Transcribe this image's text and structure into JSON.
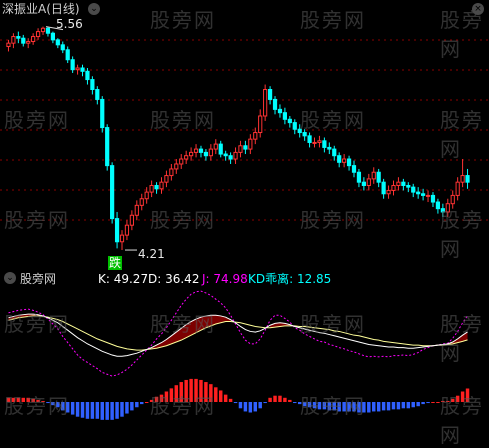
{
  "main_panel": {
    "title": "深振业A(日线)",
    "high_label": "5.56",
    "low_label": "4.21",
    "signal_text": "跌",
    "title_color": "#d0d0d0",
    "high_color": "#e6e6e6",
    "low_color": "#e6e6e6",
    "signal_color": "#00c000"
  },
  "indicator_panel": {
    "name": "股旁网",
    "k_label": "K: 49.27",
    "d_label": "D: 36.42",
    "j_label": "J: 74.98",
    "kd_label": "KD乖离: 12.85",
    "k_color": "#ffffff",
    "d_color": "#ffffff",
    "j_color": "#ff00ff",
    "kd_color": "#00ffff"
  },
  "watermark": "股旁网",
  "colors": {
    "up": "#ff3333",
    "down": "#00ffff",
    "grid": "#8b0000",
    "k_line": "#ffffff",
    "d_line": "#ffff99",
    "j_line": "#ff00ff",
    "kd_pos": "#ff2020",
    "kd_neg": "#3060ff",
    "band_fill": "#8b0000"
  },
  "chart_data": [
    {
      "type": "candlestick",
      "x": [
        "1",
        "2",
        "3",
        "4",
        "5",
        "6",
        "7",
        "8",
        "9",
        "10",
        "11",
        "12",
        "13",
        "14",
        "15",
        "16",
        "17",
        "18",
        "19",
        "20",
        "21",
        "22",
        "23",
        "24",
        "25",
        "26",
        "27",
        "28",
        "29",
        "30",
        "31",
        "32",
        "33",
        "34",
        "35",
        "36",
        "37",
        "38",
        "39",
        "40",
        "41",
        "42",
        "43",
        "44",
        "45",
        "46",
        "47",
        "48",
        "49",
        "50",
        "51",
        "52",
        "53",
        "54",
        "55",
        "56",
        "57",
        "58",
        "59",
        "60",
        "61",
        "62",
        "63",
        "64",
        "65",
        "66",
        "67",
        "68",
        "69",
        "70",
        "71",
        "72",
        "73",
        "74",
        "75",
        "76",
        "77",
        "78",
        "79",
        "80",
        "81",
        "82",
        "83",
        "84",
        "85",
        "86",
        "87",
        "88",
        "89",
        "90",
        "91",
        "92",
        "93",
        "94"
      ],
      "open": [
        5.44,
        5.46,
        5.5,
        5.49,
        5.46,
        5.47,
        5.5,
        5.53,
        5.55,
        5.52,
        5.48,
        5.45,
        5.42,
        5.36,
        5.3,
        5.31,
        5.29,
        5.24,
        5.18,
        5.12,
        4.95,
        4.72,
        4.4,
        4.26,
        4.3,
        4.36,
        4.42,
        4.48,
        4.52,
        4.56,
        4.6,
        4.58,
        4.62,
        4.66,
        4.7,
        4.73,
        4.76,
        4.78,
        4.8,
        4.82,
        4.8,
        4.78,
        4.82,
        4.85,
        4.79,
        4.78,
        4.76,
        4.8,
        4.84,
        4.82,
        4.88,
        4.92,
        5.02,
        5.18,
        5.12,
        5.06,
        5.04,
        5.0,
        4.98,
        4.94,
        4.92,
        4.9,
        4.86,
        4.86,
        4.87,
        4.83,
        4.82,
        4.78,
        4.74,
        4.76,
        4.72,
        4.68,
        4.62,
        4.6,
        4.64,
        4.68,
        4.62,
        4.55,
        4.57,
        4.6,
        4.62,
        4.6,
        4.59,
        4.56,
        4.55,
        4.54,
        4.54,
        4.5,
        4.46,
        4.44,
        4.49,
        4.54,
        4.62,
        4.66
      ],
      "close": [
        5.46,
        5.5,
        5.49,
        5.46,
        5.47,
        5.5,
        5.53,
        5.55,
        5.52,
        5.48,
        5.45,
        5.42,
        5.36,
        5.3,
        5.31,
        5.29,
        5.24,
        5.18,
        5.12,
        4.95,
        4.72,
        4.4,
        4.26,
        4.3,
        4.36,
        4.42,
        4.48,
        4.52,
        4.56,
        4.6,
        4.58,
        4.62,
        4.66,
        4.7,
        4.73,
        4.76,
        4.78,
        4.8,
        4.82,
        4.8,
        4.78,
        4.82,
        4.85,
        4.79,
        4.78,
        4.76,
        4.8,
        4.84,
        4.82,
        4.88,
        4.92,
        5.02,
        5.18,
        5.12,
        5.06,
        5.04,
        5.0,
        4.98,
        4.94,
        4.92,
        4.9,
        4.86,
        4.86,
        4.87,
        4.83,
        4.82,
        4.78,
        4.74,
        4.76,
        4.72,
        4.68,
        4.62,
        4.6,
        4.64,
        4.68,
        4.62,
        4.55,
        4.57,
        4.6,
        4.62,
        4.6,
        4.59,
        4.56,
        4.55,
        4.54,
        4.54,
        4.5,
        4.46,
        4.44,
        4.49,
        4.54,
        4.62,
        4.66,
        4.62
      ],
      "high": [
        5.48,
        5.52,
        5.53,
        5.51,
        5.49,
        5.52,
        5.55,
        5.56,
        5.56,
        5.53,
        5.49,
        5.47,
        5.44,
        5.38,
        5.33,
        5.33,
        5.31,
        5.26,
        5.2,
        5.14,
        4.97,
        4.74,
        4.44,
        4.33,
        4.39,
        4.45,
        4.51,
        4.55,
        4.59,
        4.63,
        4.62,
        4.65,
        4.69,
        4.73,
        4.76,
        4.79,
        4.81,
        4.83,
        4.85,
        4.84,
        4.82,
        4.85,
        4.88,
        4.87,
        4.81,
        4.8,
        4.83,
        4.87,
        4.87,
        4.91,
        4.95,
        5.06,
        5.21,
        5.2,
        5.14,
        5.09,
        5.07,
        5.02,
        5.0,
        4.97,
        4.94,
        4.92,
        4.89,
        4.9,
        4.89,
        4.86,
        4.84,
        4.8,
        4.79,
        4.78,
        4.75,
        4.7,
        4.65,
        4.67,
        4.71,
        4.7,
        4.64,
        4.6,
        4.63,
        4.65,
        4.64,
        4.62,
        4.61,
        4.59,
        4.58,
        4.57,
        4.56,
        4.52,
        4.49,
        4.52,
        4.57,
        4.65,
        4.76,
        4.7
      ],
      "low": [
        5.41,
        5.43,
        5.46,
        5.44,
        5.43,
        5.45,
        5.48,
        5.51,
        5.5,
        5.46,
        5.43,
        5.4,
        5.34,
        5.28,
        5.27,
        5.26,
        5.21,
        5.15,
        5.09,
        4.92,
        4.69,
        4.37,
        4.22,
        4.21,
        4.27,
        4.33,
        4.39,
        4.45,
        4.49,
        4.53,
        4.55,
        4.55,
        4.59,
        4.63,
        4.67,
        4.7,
        4.73,
        4.75,
        4.77,
        4.77,
        4.75,
        4.75,
        4.79,
        4.77,
        4.75,
        4.73,
        4.73,
        4.77,
        4.79,
        4.79,
        4.85,
        4.89,
        4.99,
        5.09,
        5.03,
        5.01,
        4.97,
        4.95,
        4.91,
        4.89,
        4.87,
        4.83,
        4.83,
        4.83,
        4.8,
        4.79,
        4.75,
        4.71,
        4.71,
        4.69,
        4.65,
        4.59,
        4.57,
        4.57,
        4.61,
        4.59,
        4.52,
        4.52,
        4.54,
        4.57,
        4.57,
        4.56,
        4.53,
        4.52,
        4.51,
        4.5,
        4.47,
        4.43,
        4.41,
        4.41,
        4.46,
        4.51,
        4.59,
        4.58
      ],
      "annotations": [
        "5.56",
        "4.21",
        "跌"
      ]
    },
    {
      "type": "line",
      "series": [
        {
          "name": "K",
          "values": [
            72,
            74,
            76,
            77,
            78,
            78,
            77,
            75,
            72,
            68,
            64,
            58,
            52,
            46,
            40,
            35,
            30,
            26,
            22,
            18,
            15,
            12,
            10,
            10,
            11,
            13,
            15,
            18,
            21,
            24,
            28,
            32,
            37,
            43,
            49,
            55,
            61,
            66,
            70,
            73,
            75,
            76,
            76,
            75,
            73,
            69,
            64,
            58,
            53,
            50,
            49,
            51,
            55,
            60,
            63,
            64,
            63,
            61,
            58,
            56,
            54,
            52,
            50,
            48,
            47,
            45,
            43,
            41,
            39,
            37,
            35,
            33,
            31,
            29,
            28,
            27,
            26,
            25,
            25,
            24,
            24,
            23,
            23,
            24,
            25,
            26,
            27,
            28,
            29,
            30,
            33,
            38,
            44,
            49.27
          ]
        },
        {
          "name": "D",
          "values": [
            68,
            70,
            72,
            73,
            74,
            75,
            75,
            74,
            73,
            71,
            69,
            66,
            62,
            58,
            54,
            50,
            46,
            42,
            38,
            35,
            32,
            29,
            26,
            24,
            22,
            21,
            20,
            20,
            21,
            22,
            23,
            25,
            27,
            30,
            33,
            36,
            40,
            44,
            48,
            52,
            56,
            59,
            62,
            64,
            66,
            66,
            65,
            64,
            62,
            60,
            58,
            57,
            56,
            56,
            57,
            58,
            59,
            59,
            59,
            58,
            58,
            57,
            56,
            55,
            54,
            53,
            51,
            50,
            48,
            46,
            44,
            43,
            41,
            39,
            37,
            36,
            34,
            33,
            32,
            31,
            30,
            29,
            28,
            28,
            27,
            27,
            27,
            28,
            28,
            29,
            30,
            32,
            34,
            36.42
          ]
        },
        {
          "name": "J",
          "values": [
            80,
            82,
            84,
            85,
            86,
            84,
            81,
            77,
            70,
            62,
            54,
            42,
            32,
            22,
            12,
            5,
            0,
            -5,
            -10,
            -16,
            -19,
            -22,
            -20,
            -16,
            -11,
            -4,
            4,
            12,
            20,
            28,
            38,
            46,
            56,
            68,
            80,
            92,
            102,
            110,
            114,
            115,
            112,
            108,
            102,
            96,
            88,
            76,
            62,
            48,
            36,
            30,
            30,
            38,
            52,
            68,
            76,
            76,
            71,
            65,
            56,
            52,
            46,
            42,
            38,
            34,
            33,
            29,
            27,
            24,
            22,
            19,
            17,
            14,
            11,
            9,
            10,
            9,
            10,
            9,
            11,
            11,
            12,
            11,
            13,
            16,
            21,
            24,
            27,
            28,
            30,
            31,
            39,
            50,
            64,
            74.98
          ]
        },
        {
          "name": "KD乖离",
          "values": [
            4,
            4,
            4,
            4,
            4,
            3,
            2,
            1,
            -1,
            -3,
            -5,
            -8,
            -10,
            -12,
            -14,
            -15,
            -16,
            -16,
            -16,
            -17,
            -17,
            -17,
            -16,
            -14,
            -11,
            -8,
            -5,
            -2,
            0,
            2,
            5,
            7,
            10,
            13,
            16,
            19,
            21,
            22,
            22,
            21,
            19,
            17,
            14,
            11,
            7,
            3,
            -1,
            -6,
            -9,
            -10,
            -9,
            -6,
            -1,
            4,
            6,
            6,
            4,
            2,
            -1,
            -2,
            -4,
            -5,
            -6,
            -7,
            -7,
            -8,
            -8,
            -9,
            -9,
            -9,
            -9,
            -10,
            -10,
            -10,
            -9,
            -9,
            -8,
            -8,
            -7,
            -7,
            -6,
            -6,
            -5,
            -4,
            -2,
            -1,
            0,
            0,
            1,
            1,
            3,
            6,
            10,
            12.85
          ]
        }
      ]
    }
  ]
}
